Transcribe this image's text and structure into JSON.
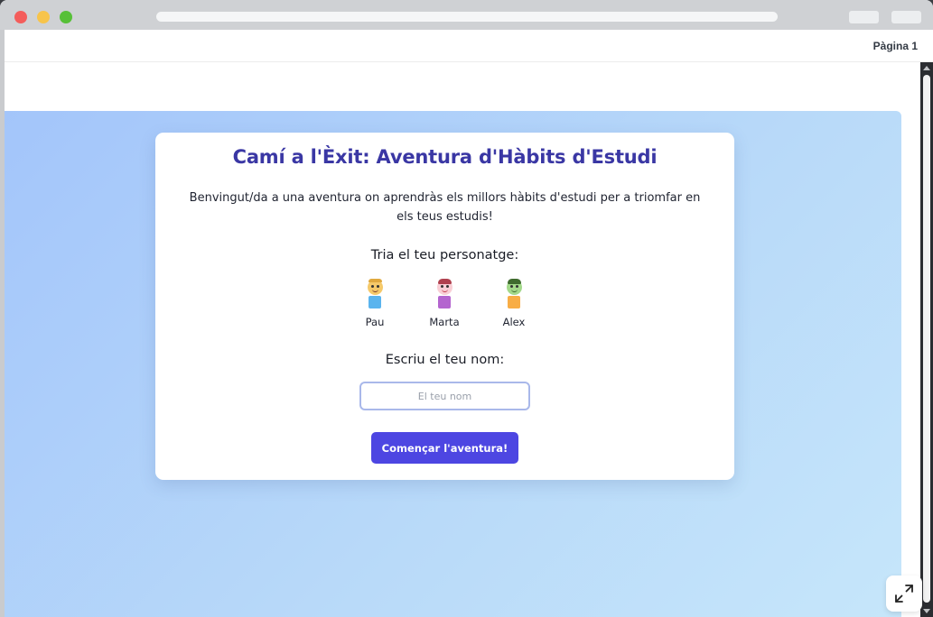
{
  "header": {
    "page_label": "Pàgina 1"
  },
  "card": {
    "title": "Camí a l'Èxit: Aventura d'Hàbits d'Estudi",
    "intro": "Benvingut/da a una aventura on aprendràs els millors hàbits d'estudi per a triomfar en els teus estudis!",
    "choose_label": "Tria el teu personatge:",
    "characters": [
      {
        "name": "Pau",
        "head_color": "#f5c96a",
        "body_color": "#5ab4ee",
        "icon": "boy-character-icon"
      },
      {
        "name": "Marta",
        "head_color": "#f9cfd6",
        "body_color": "#b465cf",
        "icon": "girl-character-icon"
      },
      {
        "name": "Alex",
        "head_color": "#a3d98a",
        "body_color": "#f8ad45",
        "icon": "kid-character-icon"
      }
    ],
    "name_label": "Escriu el teu nom:",
    "name_input": {
      "placeholder": "El teu nom",
      "value": ""
    },
    "start_button": "Començar l'aventura!"
  },
  "colors": {
    "accent": "#4d46e2",
    "title": "#3a37a4",
    "gradient_start": "#a3c5fa",
    "gradient_end": "#c6e6fa"
  },
  "icons": {
    "expand": "expand-icon"
  }
}
